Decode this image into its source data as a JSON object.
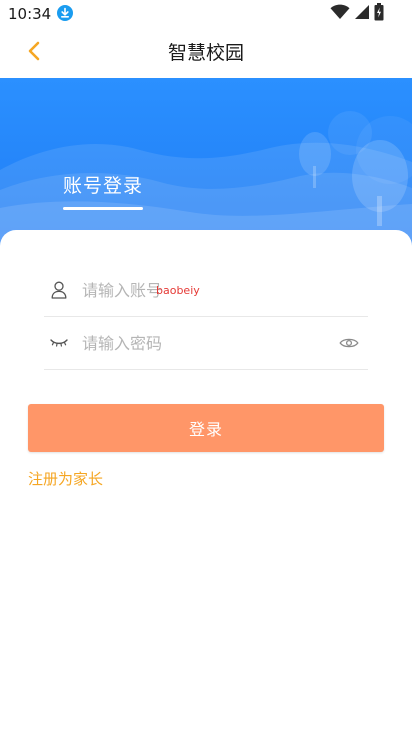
{
  "status_bar": {
    "time": "10:34",
    "download_icon": "download-icon",
    "wifi_icon": "wifi-icon",
    "signal_icon": "signal-icon",
    "battery_icon": "battery-icon"
  },
  "app_bar": {
    "title": "智慧校园",
    "back_icon": "chevron-left-icon"
  },
  "login_tabs": {
    "active_label": "账号登录"
  },
  "form": {
    "username": {
      "placeholder": "请输入账号",
      "value": "",
      "autofill_hint": "baobeiy",
      "icon": "user-icon"
    },
    "password": {
      "placeholder": "请输入密码",
      "value": "",
      "icon": "closed-eye-icon",
      "toggle_icon": "eye-icon"
    },
    "login_label": "登录",
    "register_label": "注册为家长"
  },
  "colors": {
    "accent": "#f5a623",
    "banner_blue": "#1f7cf4",
    "login_button": "#ff9668",
    "hint_red": "#e53935"
  }
}
